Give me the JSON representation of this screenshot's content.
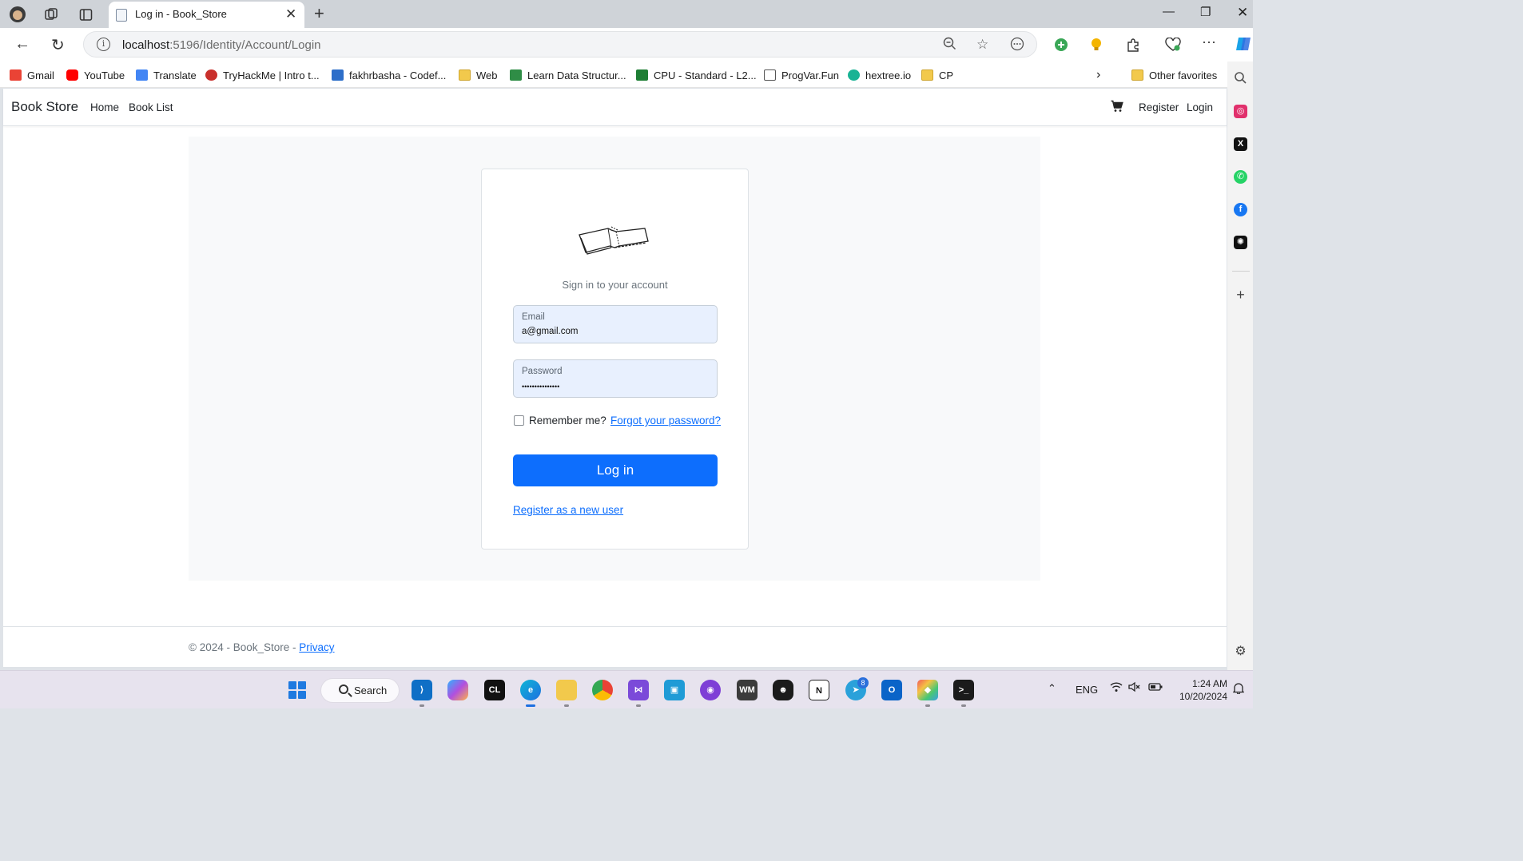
{
  "browser": {
    "tab_title": "Log in - Book_Store",
    "url_host": "localhost",
    "url_rest": ":5196/Identity/Account/Login",
    "favorites": [
      {
        "label": "Gmail",
        "color": "#ea4335"
      },
      {
        "label": "YouTube",
        "color": "#ff0000"
      },
      {
        "label": "Translate",
        "color": "#4285f4"
      },
      {
        "label": "TryHackMe | Intro t...",
        "color": "#c9302c"
      },
      {
        "label": "fakhrbasha - Codef...",
        "color": "#2d6ec9"
      },
      {
        "label": "Web",
        "color": "#f2c94c"
      },
      {
        "label": "Learn Data Structur...",
        "color": "#2f8d46"
      },
      {
        "label": "CPU - Standard - L2...",
        "color": "#1e7e34"
      },
      {
        "label": "ProgVar.Fun",
        "color": "#555555"
      },
      {
        "label": "hextree.io",
        "color": "#19b394"
      },
      {
        "label": "CP",
        "color": "#f2c94c"
      }
    ],
    "other_favorites": "Other favorites"
  },
  "site": {
    "brand": "Book Store",
    "nav": {
      "home": "Home",
      "book_list": "Book List",
      "register": "Register",
      "login": "Login"
    }
  },
  "login": {
    "subtitle": "Sign in to your account",
    "email_label": "Email",
    "email_value": "a@gmail.com",
    "password_label": "Password",
    "password_value": "•••••••••••••••",
    "remember_label": "Remember me?",
    "remember_checked": false,
    "forgot_link": "Forgot your password?",
    "submit": "Log in",
    "register_link": "Register as a new user"
  },
  "footer": {
    "text": "© 2024 - Book_Store - ",
    "privacy": "Privacy"
  },
  "taskbar": {
    "search": "Search",
    "language": "ENG",
    "time": "1:24 AM",
    "date": "10/20/2024",
    "telegram_badge": "8"
  },
  "colors": {
    "primary": "#0d6efd",
    "field_bg": "#e8f0fe",
    "page_bg": "#f8f9fa"
  }
}
